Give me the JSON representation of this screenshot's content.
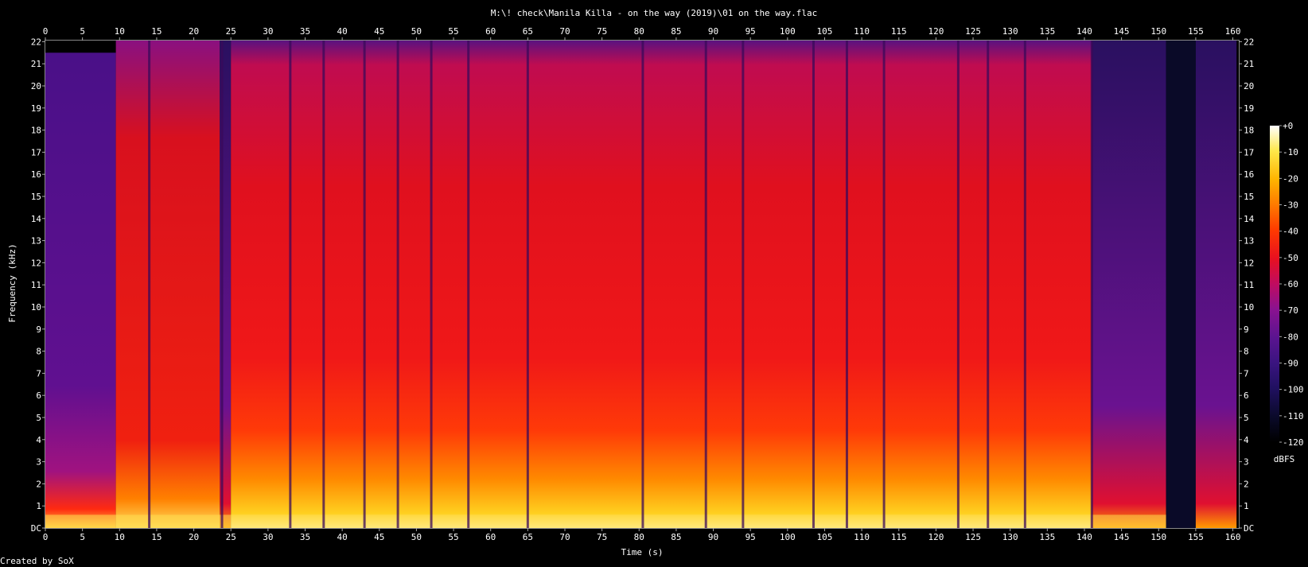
{
  "chart_data": {
    "type": "heatmap",
    "title": "M:\\! check\\Manila Killa - on the way (2019)\\01 on the way.flac",
    "xlabel": "Time (s)",
    "ylabel": "Frequency (kHz)",
    "footer": "Created by SoX",
    "xlim": [
      0,
      160.8
    ],
    "ylim": [
      0,
      22.05
    ],
    "x_ticks": [
      0,
      5,
      10,
      15,
      20,
      25,
      30,
      35,
      40,
      45,
      50,
      55,
      60,
      65,
      70,
      75,
      80,
      85,
      90,
      95,
      100,
      105,
      110,
      115,
      120,
      125,
      130,
      135,
      140,
      145,
      150,
      155,
      160
    ],
    "y_ticks": [
      "DC",
      "1",
      "2",
      "3",
      "4",
      "5",
      "6",
      "7",
      "8",
      "9",
      "10",
      "11",
      "12",
      "13",
      "14",
      "15",
      "16",
      "17",
      "18",
      "19",
      "20",
      "21",
      "22"
    ],
    "colorbar": {
      "label": "dBFS",
      "ticks": [
        "+0",
        "-10",
        "-20",
        "-30",
        "-40",
        "-50",
        "-60",
        "-70",
        "-80",
        "-90",
        "-100",
        "-110",
        "-120"
      ],
      "range": [
        -120,
        0
      ]
    },
    "regions": [
      {
        "t0": 0,
        "t1": 9.5,
        "level": "quiet-purple",
        "hf_cutoff_khz": 21.5
      },
      {
        "t0": 9.5,
        "t1": 23.5,
        "level": "red"
      },
      {
        "t0": 23.5,
        "t1": 25,
        "level": "dip"
      },
      {
        "t0": 25,
        "t1": 141,
        "level": "red-yellow-loud"
      },
      {
        "t0": 141,
        "t1": 151,
        "level": "fade-purple"
      },
      {
        "t0": 151,
        "t1": 155,
        "level": "near-silent"
      },
      {
        "t0": 155,
        "t1": 160.5,
        "level": "quiet-purple-tail"
      }
    ],
    "dark_stripes_s": [
      14,
      23.8,
      33,
      37.5,
      43,
      47.5,
      52,
      57,
      65,
      80.5,
      89,
      94,
      103.5,
      108,
      113,
      123,
      127,
      132,
      141
    ]
  }
}
